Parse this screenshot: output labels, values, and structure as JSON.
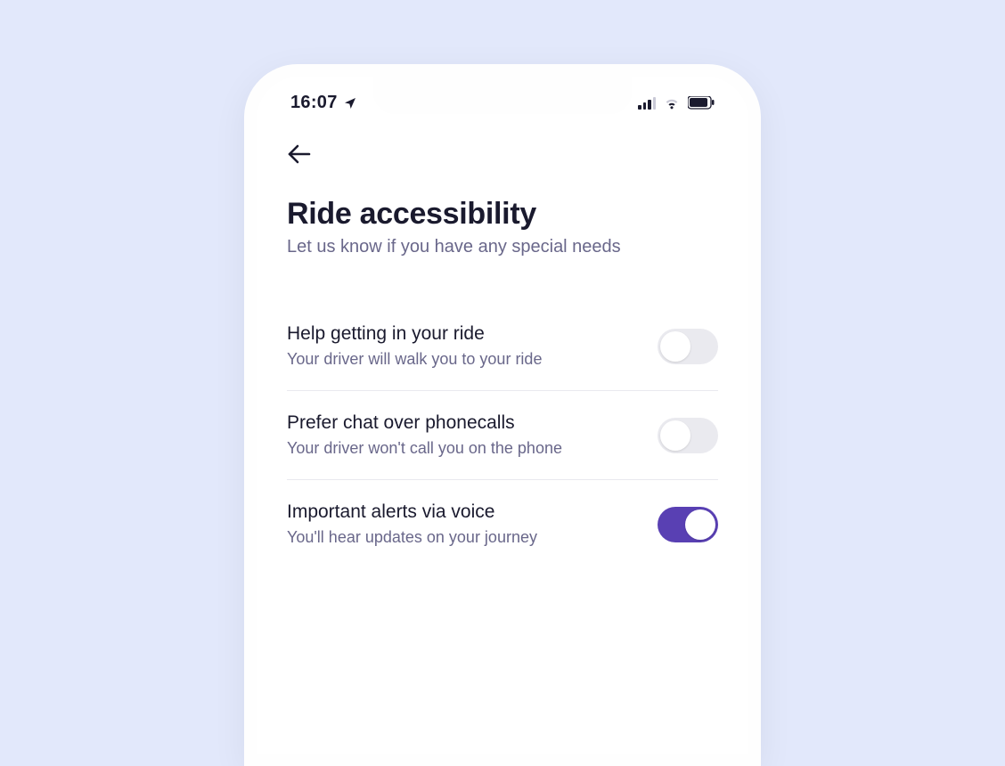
{
  "status": {
    "time": "16:07"
  },
  "page": {
    "title": "Ride accessibility",
    "subtitle": "Let us know if you have any special needs"
  },
  "options": [
    {
      "title": "Help getting in your ride",
      "desc": "Your driver will walk you to your ride",
      "on": false
    },
    {
      "title": "Prefer chat over phonecalls",
      "desc": "Your driver won't call you on the phone",
      "on": false
    },
    {
      "title": "Important alerts via voice",
      "desc": "You'll hear updates on your journey",
      "on": true
    }
  ],
  "colors": {
    "accent": "#5940b3"
  }
}
